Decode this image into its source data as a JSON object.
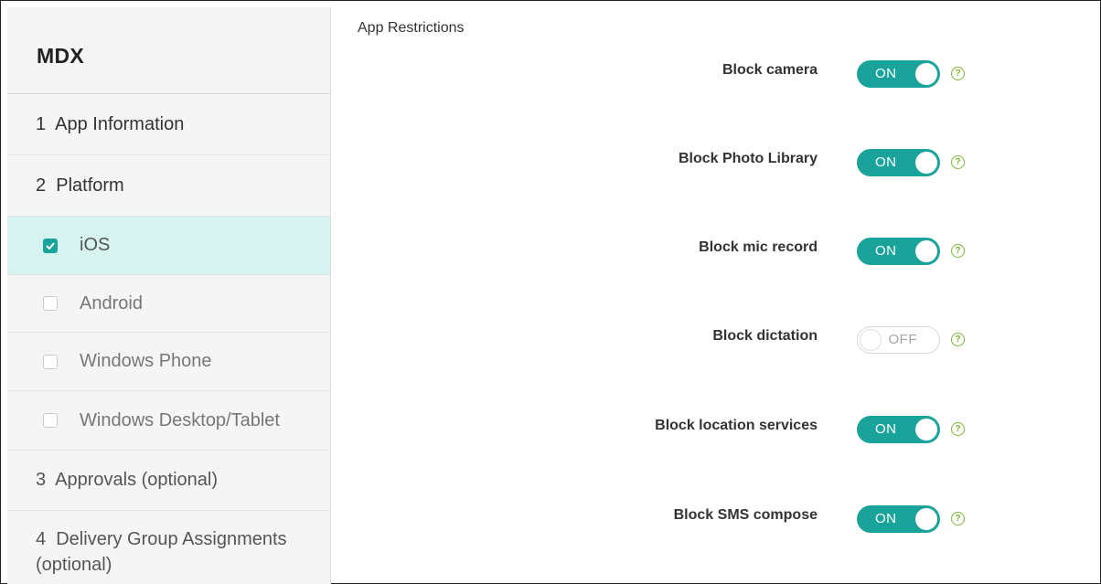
{
  "sidebar": {
    "title": "MDX",
    "steps": [
      {
        "label": "1  App Information"
      },
      {
        "label": "2  Platform"
      }
    ],
    "platforms": [
      {
        "label": "iOS",
        "checked": true
      },
      {
        "label": "Android",
        "checked": false
      },
      {
        "label": "Windows Phone",
        "checked": false
      },
      {
        "label": "Windows Desktop/Tablet",
        "checked": false
      }
    ],
    "step3": "3  Approvals (optional)",
    "step4_line1": "4  Delivery Group Assignments",
    "step4_line2": "(optional)"
  },
  "main": {
    "section_title": "App Restrictions",
    "settings": [
      {
        "label": "Block camera",
        "state": "ON"
      },
      {
        "label": "Block Photo Library",
        "state": "ON"
      },
      {
        "label": "Block mic record",
        "state": "ON"
      },
      {
        "label": "Block dictation",
        "state": "OFF"
      },
      {
        "label": "Block location services",
        "state": "ON"
      },
      {
        "label": "Block SMS compose",
        "state": "ON"
      }
    ],
    "help_glyph": "?"
  },
  "colors": {
    "accent": "#1aa39a",
    "active_row": "#d6f3ef",
    "help": "#7bb535"
  }
}
